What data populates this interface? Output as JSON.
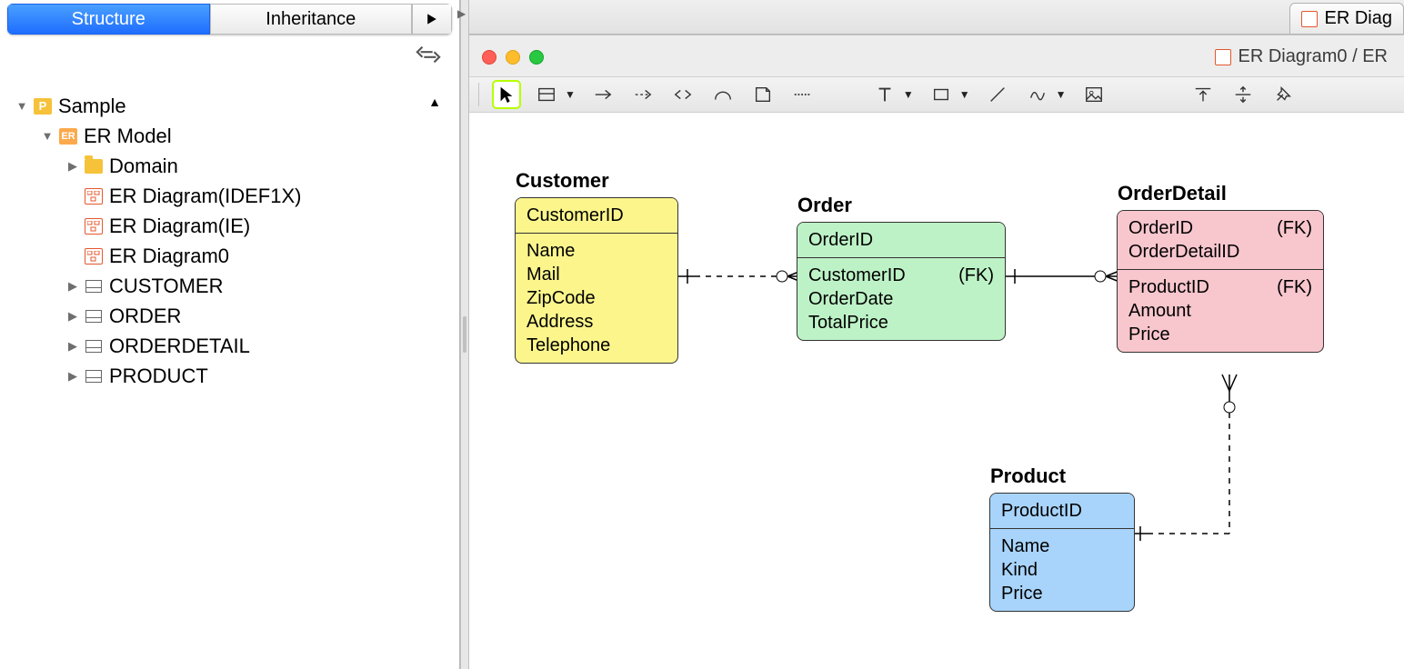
{
  "left": {
    "tabs": {
      "structure": "Structure",
      "inheritance": "Inheritance"
    },
    "tree": {
      "root": "Sample",
      "ermodel": "ER Model",
      "domain": "Domain",
      "d1": "ER Diagram(IDEF1X)",
      "d2": "ER Diagram(IE)",
      "d3": "ER Diagram0",
      "t1": "CUSTOMER",
      "t2": "ORDER",
      "t3": "ORDERDETAIL",
      "t4": "PRODUCT"
    }
  },
  "tabbar": {
    "label": "ER Diag"
  },
  "window": {
    "title": "ER Diagram0 / ER"
  },
  "entities": {
    "customer": {
      "name": "Customer",
      "pk": "CustomerID",
      "a1": "Name",
      "a2": "Mail",
      "a3": "ZipCode",
      "a4": "Address",
      "a5": "Telephone"
    },
    "order": {
      "name": "Order",
      "pk": "OrderID",
      "a1": "CustomerID",
      "a1fk": "(FK)",
      "a2": "OrderDate",
      "a3": "TotalPrice"
    },
    "orderdetail": {
      "name": "OrderDetail",
      "pk1": "OrderID",
      "pk1fk": "(FK)",
      "pk2": "OrderDetailID",
      "a1": "ProductID",
      "a1fk": "(FK)",
      "a2": "Amount",
      "a3": "Price"
    },
    "product": {
      "name": "Product",
      "pk": "ProductID",
      "a1": "Name",
      "a2": "Kind",
      "a3": "Price"
    }
  }
}
